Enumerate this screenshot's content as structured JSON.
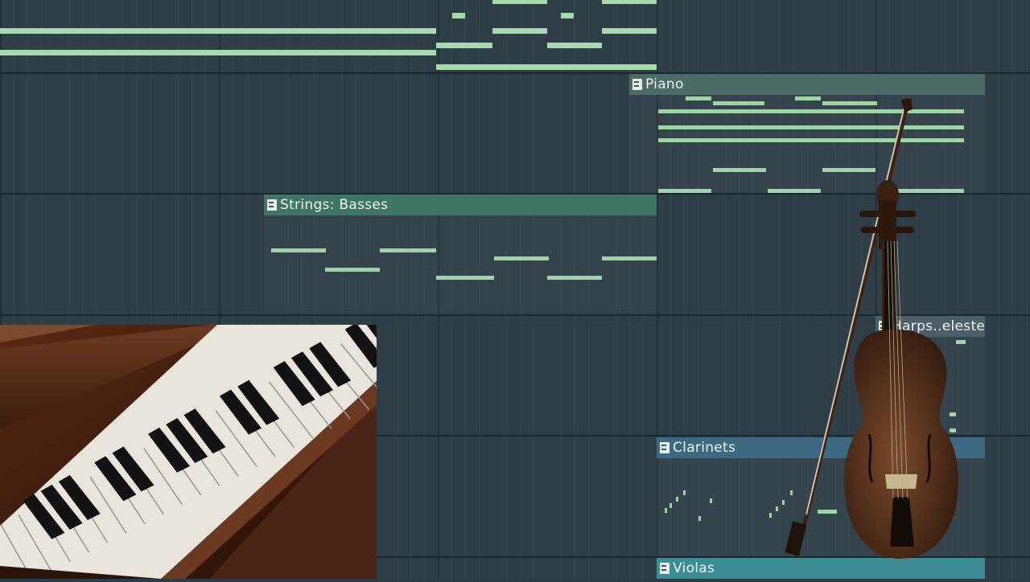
{
  "app": "Playlist",
  "tracks": [
    {
      "name": "Piano"
    },
    {
      "name": "Strings: Basses"
    },
    {
      "name": "Harps..eleste"
    },
    {
      "name": "Clarinets"
    },
    {
      "name": "Violas"
    }
  ],
  "clips": {
    "piano": {
      "title": "Piano",
      "color": "#4b6b67"
    },
    "basses": {
      "title": "Strings: Basses",
      "color": "#3f7565"
    },
    "harps": {
      "title": "Harps..eleste",
      "color": "#4b5f68"
    },
    "clarinets": {
      "title": "Clarinets",
      "color": "#3d6a82"
    },
    "violas": {
      "title": "Violas",
      "color": "#3a8d92"
    }
  },
  "colors": {
    "note": "#9fd3a8",
    "background": "#2f3d47"
  },
  "overlays": {
    "piano_image": "piano-keys-photo",
    "violin_image": "violin-and-bow-photo"
  }
}
